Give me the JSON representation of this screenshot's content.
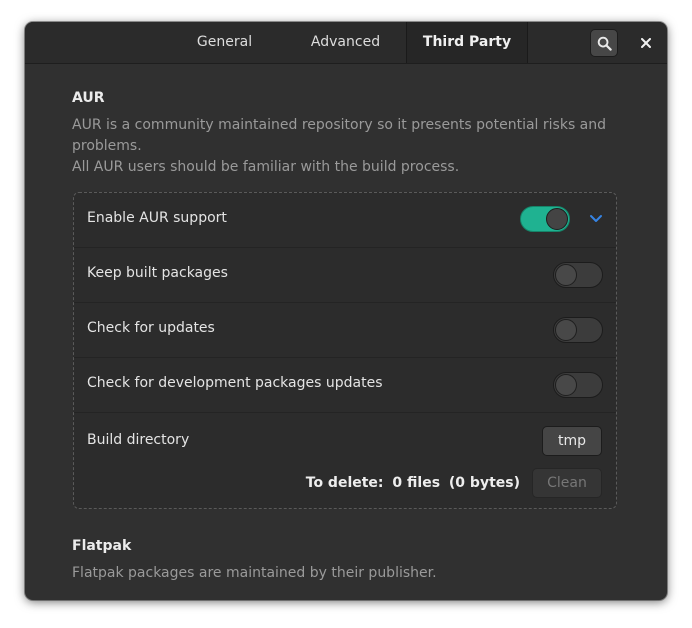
{
  "tabs": [
    {
      "label": "General"
    },
    {
      "label": "Advanced"
    },
    {
      "label": "Third Party",
      "active": true
    }
  ],
  "header": {
    "search_icon": "search-icon",
    "close_icon": "close-icon"
  },
  "aur": {
    "title": "AUR",
    "desc_line1": "AUR is a community maintained repository so it presents potential risks and problems.",
    "desc_line2": "All AUR users should be familiar with the build process.",
    "rows": {
      "enable": {
        "label": "Enable AUR support",
        "on": true
      },
      "keep": {
        "label": "Keep built packages",
        "on": false
      },
      "updates": {
        "label": "Check for updates",
        "on": false
      },
      "devel": {
        "label": "Check for development packages updates",
        "on": false
      }
    },
    "build": {
      "label": "Build directory",
      "dir_button": "tmp",
      "to_delete_label": "To delete:",
      "files": "0 files",
      "bytes": "(0 bytes)",
      "clean_button": "Clean"
    }
  },
  "flatpak": {
    "title": "Flatpak",
    "desc": "Flatpak packages are maintained by their publisher."
  },
  "colors": {
    "accent": "#1fb291",
    "chevron": "#3584e4"
  }
}
